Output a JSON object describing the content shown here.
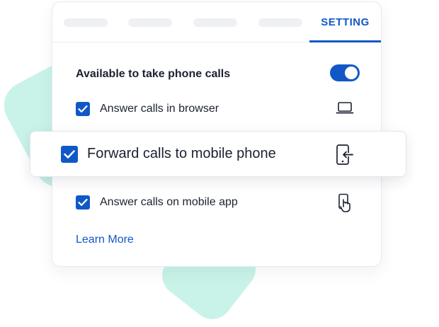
{
  "tabs": {
    "active_label": "SETTING"
  },
  "settings": {
    "availability_label": "Available to take phone calls",
    "availability_on": true,
    "options": [
      {
        "label": "Answer calls in browser",
        "checked": true,
        "icon": "laptop-icon"
      },
      {
        "label": "Forward calls to mobile phone",
        "checked": true,
        "icon": "phone-forward-icon"
      },
      {
        "label": "Answer calls on mobile app",
        "checked": true,
        "icon": "phone-tap-icon"
      }
    ],
    "learn_more": "Learn More"
  },
  "colors": {
    "accent": "#1158c7",
    "mint": "#c9f3e9",
    "text": "#1b2230"
  }
}
